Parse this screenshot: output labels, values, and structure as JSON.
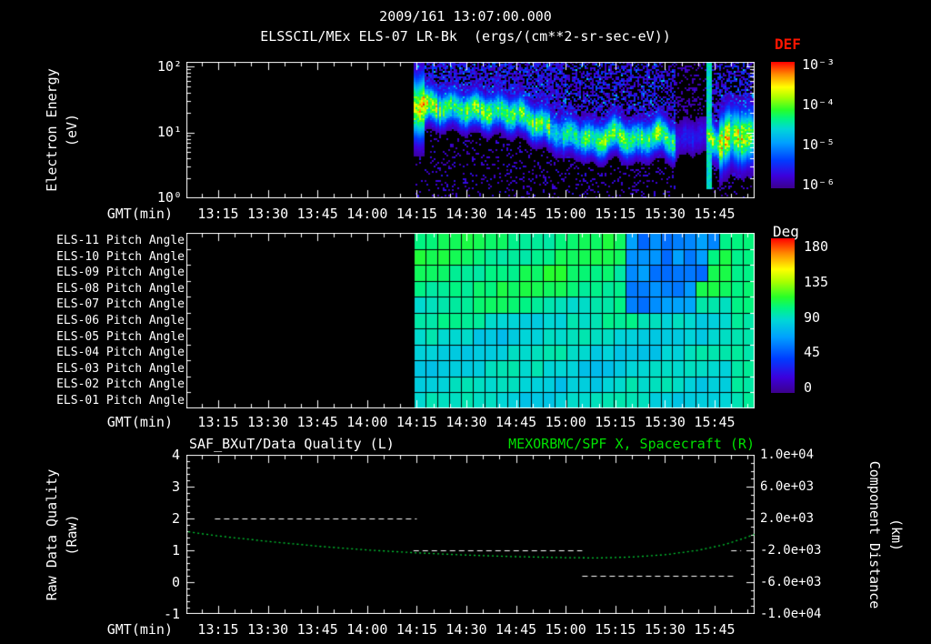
{
  "header": {
    "datetime": "2009/161 13:07:00.000"
  },
  "palette": {
    "background": "#000000",
    "text": "#ffffff",
    "def_label_red": "#ff1500",
    "right_title_green": "#00e000",
    "curve_green": "#00cc33",
    "quality_line_white": "#ffffff",
    "colorbar_low": "#3c008c",
    "colorbar_high": "#ff0000"
  },
  "time_axis": {
    "label": "GMT(min)",
    "ticks": [
      "13:15",
      "13:30",
      "13:45",
      "14:00",
      "14:15",
      "14:30",
      "14:45",
      "15:00",
      "15:15",
      "15:30",
      "15:45"
    ]
  },
  "panel_energy": {
    "title": "ELSSCIL/MEx ELS-07 LR-Bk  (ergs/(cm**2-sr-sec-eV))",
    "y_axis": {
      "title_line1": "Electron Energy",
      "title_line2": "(eV)",
      "ticks": [
        "10²",
        "10¹",
        "10⁰"
      ]
    },
    "colorbar": {
      "label": "DEF",
      "ticks": [
        "10⁻³",
        "10⁻⁴",
        "10⁻⁵",
        "10⁻⁶"
      ]
    }
  },
  "panel_pitch": {
    "row_labels": [
      "ELS-11 Pitch Angle",
      "ELS-10 Pitch Angle",
      "ELS-09 Pitch Angle",
      "ELS-08 Pitch Angle",
      "ELS-07 Pitch Angle",
      "ELS-06 Pitch Angle",
      "ELS-05 Pitch Angle",
      "ELS-04 Pitch Angle",
      "ELS-03 Pitch Angle",
      "ELS-02 Pitch Angle",
      "ELS-01 Pitch Angle"
    ],
    "colorbar": {
      "label": "Deg",
      "ticks": [
        "180",
        "135",
        "90",
        "45",
        "0"
      ]
    }
  },
  "panel_line": {
    "title_left": "SAF_BXuT/Data Quality (L)",
    "title_right": "MEXORBMC/SPF X, Spacecraft (R)",
    "left_axis": {
      "title_line1": "Raw Data Quality",
      "title_line2": "(Raw)",
      "ticks": [
        "4",
        "3",
        "2",
        "1",
        "0",
        "-1"
      ]
    },
    "right_axis": {
      "title_line1": "Component Distance",
      "title_line2": "(km)",
      "ticks": [
        "1.0e+04",
        "6.0e+03",
        "2.0e+03",
        "-2.0e+03",
        "-6.0e+03",
        "-1.0e+04"
      ]
    }
  },
  "chart_data": [
    {
      "type": "heatmap",
      "name": "electron-energy-spectrogram",
      "title": "ELSSCIL/MEx ELS-07 LR-Bk",
      "units": "ergs/(cm**2-sr-sec-eV)",
      "x_axis": {
        "label": "GMT(min)",
        "start": "13:05",
        "end": "15:57",
        "tick_labels": [
          "13:15",
          "13:30",
          "13:45",
          "14:00",
          "14:15",
          "14:30",
          "14:45",
          "15:00",
          "15:15",
          "15:30",
          "15:45"
        ]
      },
      "y_axis": {
        "label": "Electron Energy (eV)",
        "scale": "log",
        "min_ev": 1,
        "max_ev": 150
      },
      "color_axis": {
        "label": "DEF",
        "scale": "log",
        "min": 1e-06,
        "max": 0.001
      },
      "data_gap_until": "14:13",
      "band_track": {
        "t": [
          "14:15",
          "14:30",
          "14:45",
          "15:00",
          "15:15",
          "15:30",
          "15:45",
          "15:55"
        ],
        "energy_ev": [
          27,
          24,
          18,
          10,
          8,
          8,
          9,
          11
        ]
      },
      "high_energy_noise_range_ev": [
        30,
        150
      ],
      "features": [
        "dense blue/purple speckle above band until ~15:00",
        "dark vertical gap ~15:33-15:42",
        "bright vertical streak ~15:43",
        "bright green blob after 15:47"
      ]
    },
    {
      "type": "heatmap",
      "name": "pitch-angle-panels",
      "rows": [
        "ELS-11",
        "ELS-10",
        "ELS-09",
        "ELS-08",
        "ELS-07",
        "ELS-06",
        "ELS-05",
        "ELS-04",
        "ELS-03",
        "ELS-02",
        "ELS-01"
      ],
      "color_axis": {
        "label": "Deg",
        "min": 0,
        "max": 180
      },
      "data_gap_until": "14:13",
      "typical_deg": {
        "upper_rows_els11_els07": 100,
        "lower_rows_els06_els01": 84,
        "blue_patch": {
          "rows": "ELS-11..ELS-07",
          "time": "15:10-15:35",
          "deg": 55
        },
        "right_edge_after_1547": 96
      }
    },
    {
      "type": "line",
      "name": "quality-and-spacecraft-x",
      "x_axis": {
        "label": "GMT(min)",
        "start": "13:05",
        "end": "15:57"
      },
      "left_axis": {
        "label": "Raw Data Quality (Raw)",
        "range": [
          -1,
          4
        ]
      },
      "right_axis": {
        "label": "Component Distance (km)",
        "range": [
          -10000,
          10000
        ]
      },
      "series": [
        {
          "name": "MEXORBMC/SPF X, Spacecraft (R)",
          "axis": "right",
          "color": "#00cc33",
          "line_style": "dashed",
          "t_min_after_1307": [
            -1,
            8,
            23,
            38,
            53,
            68,
            83,
            98,
            113,
            123,
            133,
            143,
            153,
            161,
            167,
            170
          ],
          "km": [
            320,
            -200,
            -880,
            -1480,
            -1960,
            -2320,
            -2600,
            -2800,
            -2920,
            -2960,
            -2840,
            -2560,
            -2000,
            -1280,
            -480,
            0
          ]
        },
        {
          "name": "SAF_BXuT/Data Quality (L)",
          "axis": "left",
          "color": "#ffffff",
          "line_style": "dashed",
          "segments": [
            {
              "level": 2,
              "t0_min": 7,
              "t1_min": 68
            },
            {
              "level": 1,
              "t0_min": 67,
              "t1_min": 118
            },
            {
              "level": 0.2,
              "t0_min": 118,
              "t1_min": 164
            },
            {
              "level": 1,
              "t0_min": 163,
              "t1_min": 166
            }
          ]
        }
      ]
    }
  ]
}
